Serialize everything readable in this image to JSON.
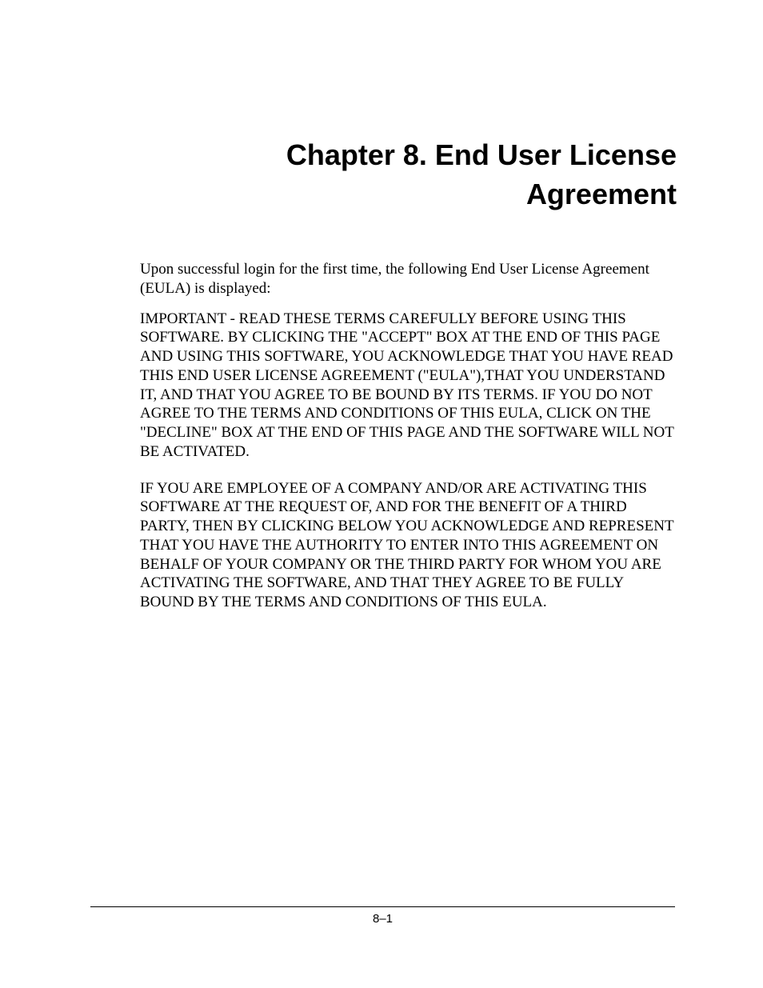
{
  "chapter": {
    "title": "Chapter 8. End User License Agreement"
  },
  "body": {
    "intro": "Upon successful login for the first time, the following End User License Agreement (EULA) is displayed:",
    "para1": "IMPORTANT - READ THESE TERMS CAREFULLY BEFORE USING THIS SOFTWARE. BY CLICKING  THE \"ACCEPT\" BOX AT THE END OF THIS PAGE AND USING THIS SOFTWARE, YOU ACKNOWLEDGE THAT YOU HAVE READ THIS END USER LICENSE AGREEMENT (\"EULA\"),THAT YOU UNDERSTAND IT, AND THAT YOU AGREE TO BE BOUND BY ITS TERMS.  IF YOU DO NOT AGREE TO THE TERMS AND CONDITIONS OF THIS EULA, CLICK ON THE \"DECLINE\" BOX AT THE END OF THIS PAGE AND THE SOFTWARE WILL NOT BE ACTIVATED.",
    "para2": "IF YOU ARE EMPLOYEE OF A COMPANY AND/OR ARE ACTIVATING THIS SOFTWARE AT THE REQUEST OF, AND FOR THE BENEFIT OF A THIRD PARTY, THEN BY CLICKING BELOW YOU ACKNOWLEDGE AND REPRESENT THAT YOU HAVE THE AUTHORITY TO ENTER INTO THIS AGREEMENT ON BEHALF OF YOUR COMPANY OR THE THIRD PARTY FOR WHOM YOU ARE ACTIVATING THE SOFTWARE, AND THAT THEY AGREE TO BE FULLY BOUND BY THE TERMS AND CONDITIONS OF THIS EULA."
  },
  "footer": {
    "page_number": "8–1"
  }
}
